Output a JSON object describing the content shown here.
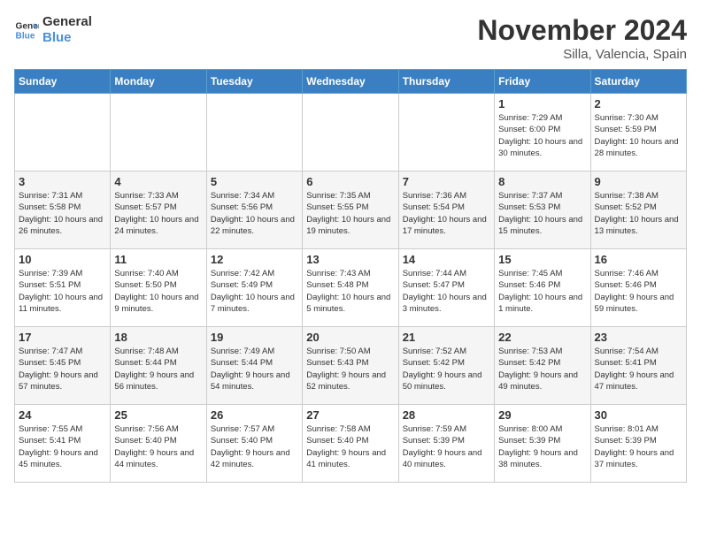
{
  "header": {
    "logo_line1": "General",
    "logo_line2": "Blue",
    "month": "November 2024",
    "location": "Silla, Valencia, Spain"
  },
  "days_of_week": [
    "Sunday",
    "Monday",
    "Tuesday",
    "Wednesday",
    "Thursday",
    "Friday",
    "Saturday"
  ],
  "weeks": [
    [
      {
        "day": "",
        "info": ""
      },
      {
        "day": "",
        "info": ""
      },
      {
        "day": "",
        "info": ""
      },
      {
        "day": "",
        "info": ""
      },
      {
        "day": "",
        "info": ""
      },
      {
        "day": "1",
        "info": "Sunrise: 7:29 AM\nSunset: 6:00 PM\nDaylight: 10 hours and 30 minutes."
      },
      {
        "day": "2",
        "info": "Sunrise: 7:30 AM\nSunset: 5:59 PM\nDaylight: 10 hours and 28 minutes."
      }
    ],
    [
      {
        "day": "3",
        "info": "Sunrise: 7:31 AM\nSunset: 5:58 PM\nDaylight: 10 hours and 26 minutes."
      },
      {
        "day": "4",
        "info": "Sunrise: 7:33 AM\nSunset: 5:57 PM\nDaylight: 10 hours and 24 minutes."
      },
      {
        "day": "5",
        "info": "Sunrise: 7:34 AM\nSunset: 5:56 PM\nDaylight: 10 hours and 22 minutes."
      },
      {
        "day": "6",
        "info": "Sunrise: 7:35 AM\nSunset: 5:55 PM\nDaylight: 10 hours and 19 minutes."
      },
      {
        "day": "7",
        "info": "Sunrise: 7:36 AM\nSunset: 5:54 PM\nDaylight: 10 hours and 17 minutes."
      },
      {
        "day": "8",
        "info": "Sunrise: 7:37 AM\nSunset: 5:53 PM\nDaylight: 10 hours and 15 minutes."
      },
      {
        "day": "9",
        "info": "Sunrise: 7:38 AM\nSunset: 5:52 PM\nDaylight: 10 hours and 13 minutes."
      }
    ],
    [
      {
        "day": "10",
        "info": "Sunrise: 7:39 AM\nSunset: 5:51 PM\nDaylight: 10 hours and 11 minutes."
      },
      {
        "day": "11",
        "info": "Sunrise: 7:40 AM\nSunset: 5:50 PM\nDaylight: 10 hours and 9 minutes."
      },
      {
        "day": "12",
        "info": "Sunrise: 7:42 AM\nSunset: 5:49 PM\nDaylight: 10 hours and 7 minutes."
      },
      {
        "day": "13",
        "info": "Sunrise: 7:43 AM\nSunset: 5:48 PM\nDaylight: 10 hours and 5 minutes."
      },
      {
        "day": "14",
        "info": "Sunrise: 7:44 AM\nSunset: 5:47 PM\nDaylight: 10 hours and 3 minutes."
      },
      {
        "day": "15",
        "info": "Sunrise: 7:45 AM\nSunset: 5:46 PM\nDaylight: 10 hours and 1 minute."
      },
      {
        "day": "16",
        "info": "Sunrise: 7:46 AM\nSunset: 5:46 PM\nDaylight: 9 hours and 59 minutes."
      }
    ],
    [
      {
        "day": "17",
        "info": "Sunrise: 7:47 AM\nSunset: 5:45 PM\nDaylight: 9 hours and 57 minutes."
      },
      {
        "day": "18",
        "info": "Sunrise: 7:48 AM\nSunset: 5:44 PM\nDaylight: 9 hours and 56 minutes."
      },
      {
        "day": "19",
        "info": "Sunrise: 7:49 AM\nSunset: 5:44 PM\nDaylight: 9 hours and 54 minutes."
      },
      {
        "day": "20",
        "info": "Sunrise: 7:50 AM\nSunset: 5:43 PM\nDaylight: 9 hours and 52 minutes."
      },
      {
        "day": "21",
        "info": "Sunrise: 7:52 AM\nSunset: 5:42 PM\nDaylight: 9 hours and 50 minutes."
      },
      {
        "day": "22",
        "info": "Sunrise: 7:53 AM\nSunset: 5:42 PM\nDaylight: 9 hours and 49 minutes."
      },
      {
        "day": "23",
        "info": "Sunrise: 7:54 AM\nSunset: 5:41 PM\nDaylight: 9 hours and 47 minutes."
      }
    ],
    [
      {
        "day": "24",
        "info": "Sunrise: 7:55 AM\nSunset: 5:41 PM\nDaylight: 9 hours and 45 minutes."
      },
      {
        "day": "25",
        "info": "Sunrise: 7:56 AM\nSunset: 5:40 PM\nDaylight: 9 hours and 44 minutes."
      },
      {
        "day": "26",
        "info": "Sunrise: 7:57 AM\nSunset: 5:40 PM\nDaylight: 9 hours and 42 minutes."
      },
      {
        "day": "27",
        "info": "Sunrise: 7:58 AM\nSunset: 5:40 PM\nDaylight: 9 hours and 41 minutes."
      },
      {
        "day": "28",
        "info": "Sunrise: 7:59 AM\nSunset: 5:39 PM\nDaylight: 9 hours and 40 minutes."
      },
      {
        "day": "29",
        "info": "Sunrise: 8:00 AM\nSunset: 5:39 PM\nDaylight: 9 hours and 38 minutes."
      },
      {
        "day": "30",
        "info": "Sunrise: 8:01 AM\nSunset: 5:39 PM\nDaylight: 9 hours and 37 minutes."
      }
    ]
  ]
}
